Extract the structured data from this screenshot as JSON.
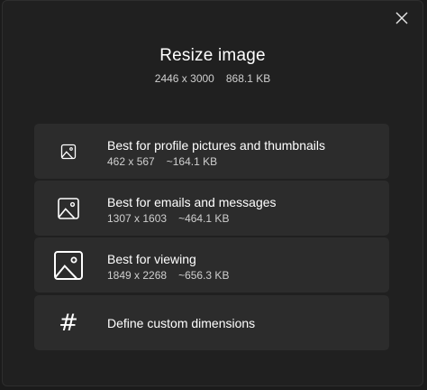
{
  "dialog": {
    "title": "Resize image",
    "original_dimensions": "2446 x 3000",
    "original_size": "868.1 KB",
    "close_icon": "close-icon"
  },
  "options": [
    {
      "label": "Best for profile pictures and thumbnails",
      "dimensions": "462 x 567",
      "size": "~164.1 KB",
      "icon": "image-icon-small"
    },
    {
      "label": "Best for emails and messages",
      "dimensions": "1307 x 1603",
      "size": "~464.1 KB",
      "icon": "image-icon-medium"
    },
    {
      "label": "Best for viewing",
      "dimensions": "1849 x 2268",
      "size": "~656.3 KB",
      "icon": "image-icon-large"
    },
    {
      "label": "Define custom dimensions",
      "icon": "hash-icon"
    }
  ],
  "colors": {
    "background": "#202020",
    "card": "#2c2c2c",
    "text": "#ffffff",
    "secondary_text": "#cfcfcf"
  }
}
